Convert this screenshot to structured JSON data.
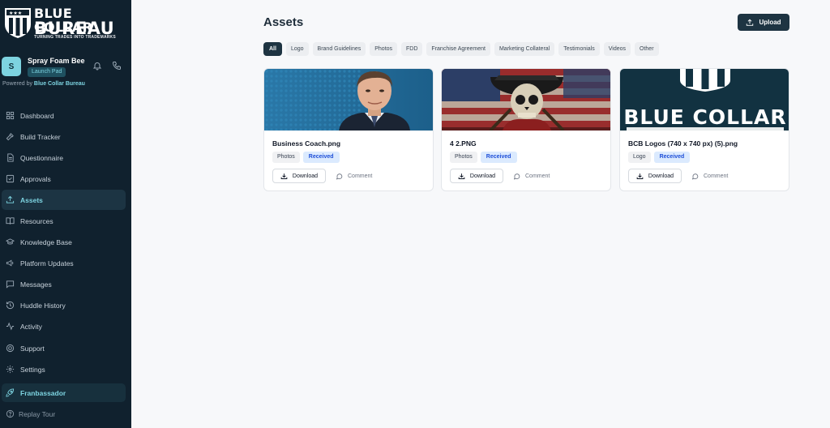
{
  "brand": {
    "line1": "BLUE COLLAR",
    "line2": "BUREAU",
    "tagline": "TURNING TRADES INTO TRADEMARKS"
  },
  "profile": {
    "initial": "S",
    "name": "Spray Foam Bee",
    "badge": "Launch Pad",
    "powered_prefix": "Powered by",
    "powered_brand": "Blue Collar Bureau"
  },
  "nav": {
    "items": [
      {
        "label": "Dashboard",
        "icon": "grid-icon"
      },
      {
        "label": "Build Tracker",
        "icon": "hammer-icon"
      },
      {
        "label": "Questionnaire",
        "icon": "document-icon"
      },
      {
        "label": "Approvals",
        "icon": "check-square-icon"
      },
      {
        "label": "Assets",
        "icon": "upload-icon",
        "active": true
      },
      {
        "label": "Resources",
        "icon": "book-icon"
      },
      {
        "label": "Knowledge Base",
        "icon": "graduation-cap-icon"
      },
      {
        "label": "Platform Updates",
        "icon": "megaphone-icon"
      },
      {
        "label": "Messages",
        "icon": "chat-icon"
      },
      {
        "label": "Huddle History",
        "icon": "history-icon"
      },
      {
        "label": "Activity",
        "icon": "activity-icon"
      },
      {
        "label": "Support",
        "icon": "help-icon"
      },
      {
        "label": "Settings",
        "icon": "gear-icon"
      }
    ],
    "franbassador": "Franbassador",
    "replay": "Replay Tour"
  },
  "main": {
    "title": "Assets",
    "upload_label": "Upload",
    "filters": [
      "All",
      "Logo",
      "Brand Guidelines",
      "Photos",
      "FDD",
      "Franchise Agreement",
      "Marketing Collateral",
      "Testimonials",
      "Videos",
      "Other"
    ],
    "active_filter": "All",
    "download_label": "Download",
    "comment_label": "Comment",
    "cards": [
      {
        "file": "Business Coach.png",
        "category": "Photos",
        "status": "Received"
      },
      {
        "file": "4 2.PNG",
        "category": "Photos",
        "status": "Received"
      },
      {
        "file": "BCB Logos (740 x 740 px) (5).png",
        "category": "Logo",
        "status": "Received"
      }
    ],
    "card3_image_text": "BLUE COLLAR"
  },
  "colors": {
    "sidebar_bg": "#10212e",
    "accent": "#7dd3e0",
    "primary_button": "#1e3442",
    "received_bg": "#dbeafe",
    "received_text": "#1d4ed8"
  }
}
